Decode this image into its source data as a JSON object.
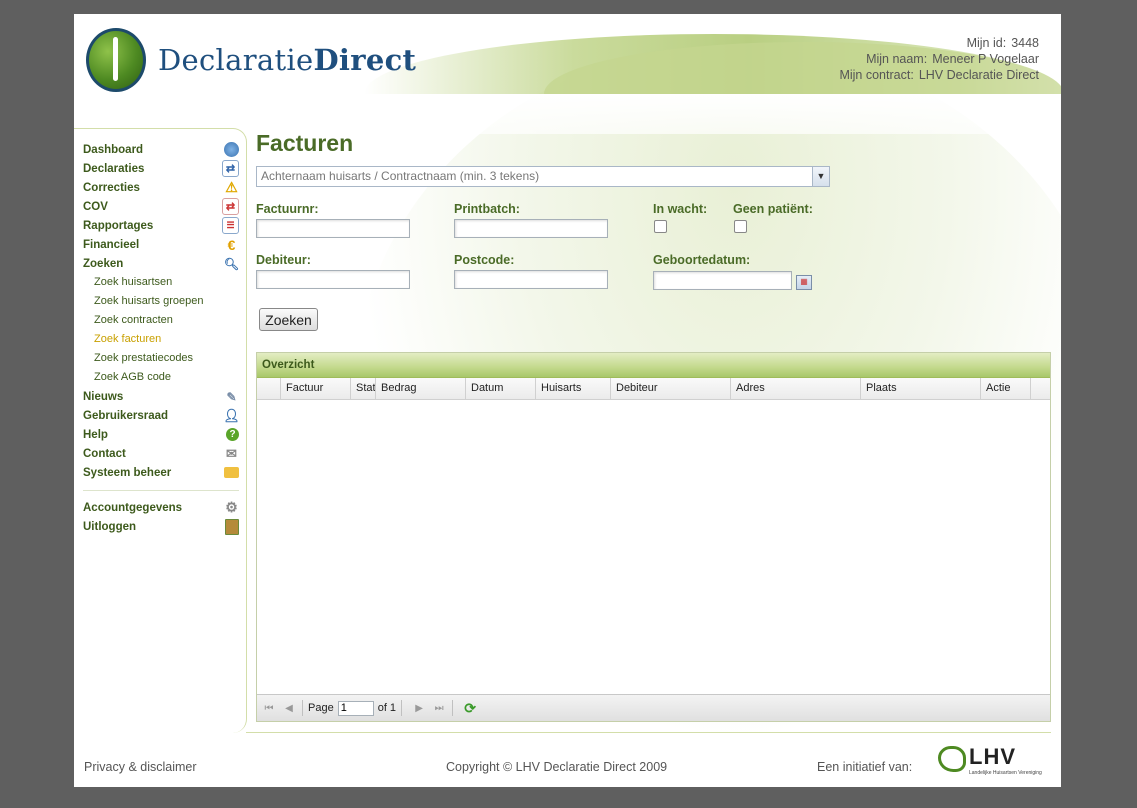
{
  "brand": {
    "logo_a": "Declaratie",
    "logo_b": "Direct"
  },
  "user": {
    "id_label": "Mijn id:",
    "id_value": "3448",
    "name_label": "Mijn naam:",
    "name_value": "Meneer P Vogelaar",
    "contract_label": "Mijn contract:",
    "contract_value": "LHV Declaratie Direct"
  },
  "sidebar": {
    "dashboard": "Dashboard",
    "declaraties": "Declaraties",
    "correcties": "Correcties",
    "cov": "COV",
    "rapportages": "Rapportages",
    "financieel": "Financieel",
    "zoeken": "Zoeken",
    "sub": [
      "Zoek huisartsen",
      "Zoek huisarts groepen",
      "Zoek contracten",
      "Zoek facturen",
      "Zoek prestatiecodes",
      "Zoek AGB code"
    ],
    "active_sub": "Zoek facturen",
    "nieuws": "Nieuws",
    "gebruikersraad": "Gebruikersraad",
    "help": "Help",
    "contact": "Contact",
    "systeem": "Systeem beheer",
    "account": "Accountgegevens",
    "uitloggen": "Uitloggen"
  },
  "main": {
    "title": "Facturen",
    "combo_placeholder": "Achternaam huisarts / Contractnaam (min. 3 tekens)",
    "factuurnr_label": "Factuurnr:",
    "printbatch_label": "Printbatch:",
    "inwacht_label": "In wacht:",
    "geenpatient_label": "Geen patiënt:",
    "debiteur_label": "Debiteur:",
    "postcode_label": "Postcode:",
    "geboortedatum_label": "Geboortedatum:",
    "search_button": "Zoeken"
  },
  "grid": {
    "title": "Overzicht",
    "columns": [
      "",
      "Factuur",
      "Stat",
      "Bedrag",
      "Datum",
      "Huisarts",
      "Debiteur",
      "Adres",
      "Plaats",
      "Actie",
      ""
    ],
    "page_label": "Page",
    "page_value": "1",
    "of_label": "of 1"
  },
  "footer": {
    "privacy": "Privacy & disclaimer",
    "copyright": "Copyright © LHV Declaratie Direct 2009",
    "initiative": "Een initiatief van:",
    "lhv_name": "LHV",
    "lhv_sub": "Landelijke Huisartsen Vereniging"
  },
  "colors": {
    "accent_green": "#4a6b27",
    "nav_green": "#3d5a1c",
    "active_sub": "#c8a000"
  }
}
